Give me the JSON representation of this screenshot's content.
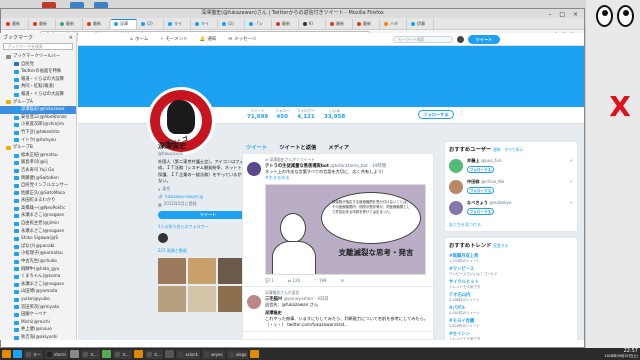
{
  "window": {
    "title": "深澤猫史(@fukazawan)さん | Twitterからの返信付きツイート - Mozilla Firefox"
  },
  "tabs": [
    {
      "label": "最新",
      "color": "#d33"
    },
    {
      "label": "最新",
      "color": "#d33"
    },
    {
      "label": "最新",
      "color": "#3a8"
    },
    {
      "label": "最新",
      "color": "#d33"
    },
    {
      "label": "深澤",
      "color": "#1da1f2",
      "active": true
    },
    {
      "label": "(2)",
      "color": "#1da1f2"
    },
    {
      "label": "マイ",
      "color": "#1da1f2"
    },
    {
      "label": "マイ",
      "color": "#1da1f2"
    },
    {
      "label": "(2)",
      "color": "#1da1f2"
    },
    {
      "label": "「シ",
      "color": "#1da1f2"
    },
    {
      "label": "最新",
      "color": "#d33"
    },
    {
      "label": "Kr",
      "color": "#333"
    },
    {
      "label": "最新",
      "color": "#d33"
    },
    {
      "label": "最新",
      "color": "#d33"
    },
    {
      "label": "ハタ",
      "color": "#e80"
    },
    {
      "label": "伊藤",
      "color": "#1da1f2"
    }
  ],
  "nav": {
    "url": "https://twitter.com/fukazawan/with_replies"
  },
  "sidebar": {
    "title": "ブックマーク",
    "search_placeholder": "ブックマークを検索",
    "items": [
      {
        "label": "ブックマークツールバー",
        "color": "#888"
      },
      {
        "label": "自民党",
        "color": "#2a6fbd"
      },
      {
        "label": "Twitterの画面を特殊",
        "color": "#1da1f2"
      },
      {
        "label": "報道・ぐらばの大誤算",
        "color": "#1da1f2"
      },
      {
        "label": "共同・紅鮭(報道)",
        "color": "#1da1f2"
      },
      {
        "label": "報道・ぐらばの大誤算",
        "color": "#1da1f2"
      },
      {
        "label": "グループA",
        "color": "#e5b400"
      },
      {
        "label": "深澤猫史(@fukazawa",
        "color": "#1da1f2",
        "selected": true
      },
      {
        "label": "安倍晋三(@AbeShinzo",
        "color": "#1da1f2"
      },
      {
        "label": "小泉進次郎(@shinjiro",
        "color": "#1da1f2"
      },
      {
        "label": "竹下亘(@takeshita",
        "color": "#1da1f2"
      },
      {
        "label": "イトウ(@itohyou",
        "color": "#1da1f2"
      },
      {
        "label": "グループB",
        "color": "#e5b400"
      },
      {
        "label": "松本正紀(@matsu",
        "color": "#1da1f2"
      },
      {
        "label": "飯島孝司(@iij",
        "color": "#1da1f2"
      },
      {
        "label": "吉永寿司 Yuji Go",
        "color": "#1da1f2"
      },
      {
        "label": "齊藤健(@SaitoKen",
        "color": "#1da1f2"
      },
      {
        "label": "自民党インフルエンサー",
        "color": "#1da1f2"
      },
      {
        "label": "佐藤正久(@SatoMasa",
        "color": "#1da1f2"
      },
      {
        "label": "永田町まるわかり",
        "color": "#1da1f2"
      },
      {
        "label": "高橋雄一(@NeoPolitic",
        "color": "#1da1f2"
      },
      {
        "label": "永瀬まさこ(@nagase",
        "color": "#1da1f2"
      },
      {
        "label": "自由民主党(@jimin",
        "color": "#1da1f2"
      },
      {
        "label": "永瀬まさこ(@nagase",
        "color": "#1da1f2"
      },
      {
        "label": "Shiko Sigawa(@S",
        "color": "#1da1f2"
      },
      {
        "label": "ぱなび(@panabi",
        "color": "#1da1f2"
      },
      {
        "label": "小松理子(@komatsu",
        "color": "#1da1f2"
      },
      {
        "label": "中古先生(@chuko",
        "color": "#1da1f2"
      },
      {
        "label": "飛騨牛(@hida_gyu",
        "color": "#1da1f2"
      },
      {
        "label": "くまちゃん(@kuma",
        "color": "#1da1f2"
      },
      {
        "label": "永瀬まさこ(@nagase",
        "color": "#1da1f2"
      },
      {
        "label": "山田博(@yamada",
        "color": "#1da1f2"
      },
      {
        "label": "yuiko(@yuiko",
        "color": "#1da1f2"
      },
      {
        "label": "宮田英次(@miyata",
        "color": "#1da1f2"
      },
      {
        "label": "田園ケーべナ",
        "color": "#1da1f2"
      },
      {
        "label": "Michi(@michi",
        "color": "#1da1f2"
      },
      {
        "label": "井上健(@inoue",
        "color": "#1da1f2"
      },
      {
        "label": "秋吉海(@akiyoshi",
        "color": "#1da1f2"
      },
      {
        "label": "有村泰(@arimura",
        "color": "#1da1f2"
      }
    ]
  },
  "twitter": {
    "nav": {
      "home": "ホーム",
      "moments": "モーメント",
      "notifications": "通知",
      "messages": "メッセージ",
      "search_placeholder": "キーワード検索",
      "tweet_button": "ツイート"
    },
    "stats": [
      {
        "label": "ツイート",
        "value": "71,699"
      },
      {
        "label": "フォロー",
        "value": "450"
      },
      {
        "label": "フォロワー",
        "value": "4,121"
      },
      {
        "label": "いいね",
        "value": "33,958"
      }
    ],
    "follow_label": "フォローする",
    "profile": {
      "name": "深澤猫史",
      "handle": "@fukazawan",
      "bio": "外国人（第二東京弁護士会）。アイコンはフォロワーの一方で作成。ＩＴ法務（システム開発紛争、ネットトラブル・個人情報保護、ＩＴ企業の一般法務）をやっているが、社会性はあまりない。",
      "location": "東京",
      "url": "fukazawa-lawyer.jp",
      "joined": "2012年5月に登録",
      "tweet_to_button": "ツイート",
      "followers_you_know": "1人の知り合いのフォロワー",
      "photos_link": "221 画像と動画"
    },
    "avatar_text": "ペン・ゴ",
    "tabs": [
      "ツイート",
      "ツイートと返信",
      "メディア"
    ],
    "tweets": [
      {
        "context": "深澤猫史さんがリツイート",
        "name": "テトラの生徒減量な黒夜場実bot",
        "handle": "@tetoratama_bot · 19時間",
        "text": "ネット上の冷淡な言葉すべての言語を大切に、広く共有しよう！",
        "link": "#生きる作法",
        "media_bubble": "仮保険が指定する医療機関を受け付けないことは、その医療機関内、他院の受診等が、同医療機関として許容出来る申請を受けては定まった。",
        "media_phrase": "支離滅裂な思考・発言",
        "actions": {
          "reply": "1",
          "retweet": "126",
          "like": "199"
        }
      },
      {
        "context": "深澤猫史さんが返信",
        "name": "三毛猫Ｍ",
        "handle": "@yoneyamen · 4日前",
        "text": "返信先：@fukazawan さん",
        "name2": "深澤猫史",
        "text2": "これやった無事、いますにもしてみたら、判断能力について名前を参考にしてみたら。（・ｖ・） twitter.com/fukazawan/stat...",
        "actions": {
          "reply": "",
          "retweet": "",
          "like": ""
        }
      }
    ],
    "who_to_follow": {
      "title": "おすすめユーザー",
      "refresh": "更新 · すべて表示",
      "users": [
        {
          "name": "井藤上",
          "handle": "@pos_fun",
          "color": "#5b7"
        },
        {
          "name": "中田修",
          "handle": "@chiso_Kei",
          "color": "#b86"
        },
        {
          "name": "なべきょう",
          "handle": "@nabekyo",
          "color": "#87a"
        }
      ],
      "follow_label": "フォローする",
      "find_friends": "友だちを見つける"
    },
    "trends": {
      "title": "おすすめトレンド",
      "change": "変更する",
      "items": [
        {
          "name": "#無職月収上昇",
          "sub": "1,234件のツイート"
        },
        {
          "name": "#ワンピース",
          "sub": "ワンピースでいいよ！ゴールド"
        },
        {
          "name": "サイクルヒット",
          "sub": "トレンドで人気です"
        },
        {
          "name": "テオ石山内",
          "sub": "2,186件のツイート"
        },
        {
          "name": "#パボル",
          "sub": "2,002件のツイート"
        },
        {
          "name": "#モヨイ会議",
          "sub": "1,820件のツイート"
        },
        {
          "name": "#セイシン",
          "sub": "トレンドで人気です"
        },
        {
          "name": "#高橋 はる",
          "sub": "トレンドで人気です"
        },
        {
          "name": "特殊機動隊IDNEI",
          "sub": "#mugimug_mua"
        }
      ]
    }
  },
  "taskbar": {
    "items": [
      {
        "label": "",
        "color": "#e08a00"
      },
      {
        "label": "",
        "color": "#1da1f2"
      },
      {
        "label": "ター",
        "color": "#555"
      },
      {
        "label": "xterm",
        "color": "#222"
      },
      {
        "label": "",
        "color": "#888"
      },
      {
        "label": "ス...",
        "color": "#555"
      },
      {
        "label": "",
        "color": "#5a5"
      },
      {
        "label": "ス...",
        "color": "#555"
      },
      {
        "label": "",
        "color": "#e08a00"
      },
      {
        "label": "ス...",
        "color": "#555"
      },
      {
        "label": "",
        "color": "#555"
      },
      {
        "label": "xclock",
        "color": "#444"
      },
      {
        "label": "xeyes",
        "color": "#444"
      },
      {
        "label": "xlogo",
        "color": "#444"
      },
      {
        "label": "",
        "color": "#e08a00"
      }
    ],
    "time": "22:57",
    "date": "2018年09月15日(土)"
  }
}
